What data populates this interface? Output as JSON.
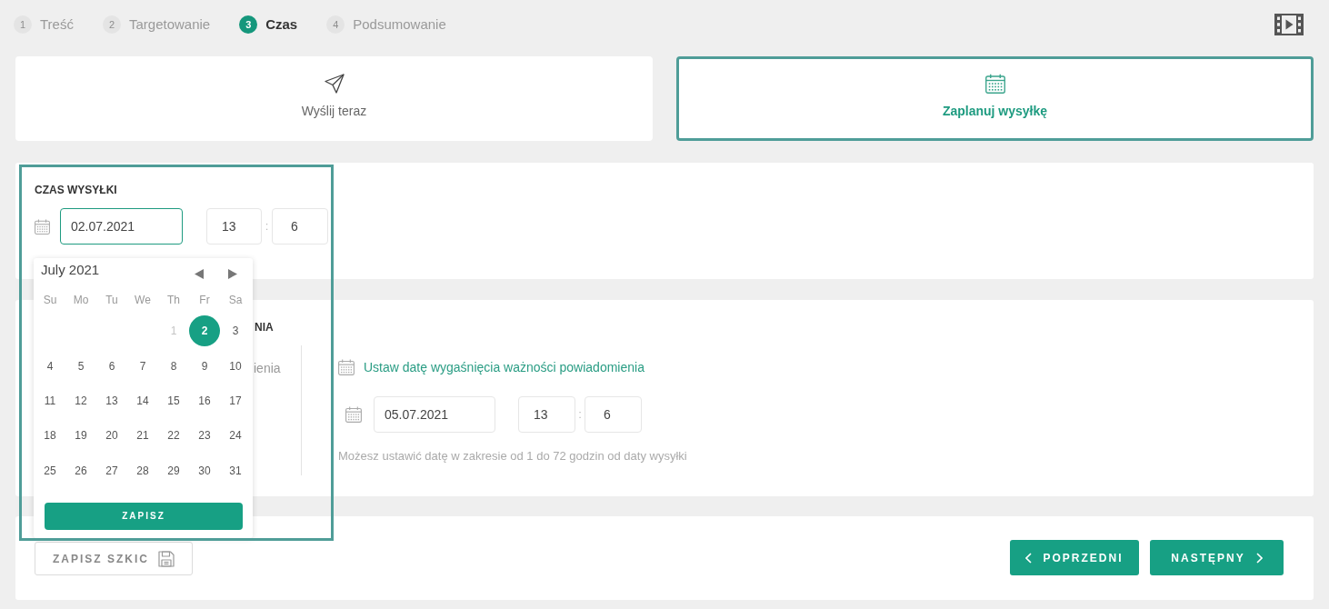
{
  "steps": [
    {
      "number": "1",
      "label": "Treść",
      "selected": false
    },
    {
      "number": "2",
      "label": "Targetowanie",
      "selected": false
    },
    {
      "number": "3",
      "label": "Czas",
      "selected": true
    },
    {
      "number": "4",
      "label": "Podsumowanie",
      "selected": false
    }
  ],
  "send_options": [
    {
      "kind": "now",
      "label": "Wyślij teraz",
      "selected": false
    },
    {
      "kind": "schedule",
      "label": "Zaplanuj wysyłkę",
      "selected": true
    }
  ],
  "send_time": {
    "title": "CZAS WYSYŁKI",
    "date": {
      "value": "02.07.2021",
      "focused": true
    },
    "hour": "13",
    "separator": ":",
    "minute": "6"
  },
  "date_picker": {
    "month": "July 2021",
    "weekdays": [
      "Su",
      "Mo",
      "Tu",
      "We",
      "Th",
      "Fr",
      "Sa"
    ],
    "weeks": [
      [
        {
          "label": "1",
          "disabled": true,
          "selected": false
        },
        {
          "label": "2",
          "disabled": false,
          "selected": true
        },
        {
          "label": "3",
          "disabled": false,
          "selected": false
        }
      ],
      [
        {
          "label": "4",
          "disabled": false,
          "selected": false
        },
        {
          "label": "5",
          "disabled": false,
          "selected": false
        },
        {
          "label": "6",
          "disabled": false,
          "selected": false
        },
        {
          "label": "7",
          "disabled": false,
          "selected": false
        },
        {
          "label": "8",
          "disabled": false,
          "selected": false
        },
        {
          "label": "9",
          "disabled": false,
          "selected": false
        },
        {
          "label": "10",
          "disabled": false,
          "selected": false
        }
      ],
      [
        {
          "label": "11",
          "disabled": false,
          "selected": false
        },
        {
          "label": "12",
          "disabled": false,
          "selected": false
        },
        {
          "label": "13",
          "disabled": false,
          "selected": false
        },
        {
          "label": "14",
          "disabled": false,
          "selected": false
        },
        {
          "label": "15",
          "disabled": false,
          "selected": false
        },
        {
          "label": "16",
          "disabled": false,
          "selected": false
        },
        {
          "label": "17",
          "disabled": false,
          "selected": false
        }
      ],
      [
        {
          "label": "18",
          "disabled": false,
          "selected": false
        },
        {
          "label": "19",
          "disabled": false,
          "selected": false
        },
        {
          "label": "20",
          "disabled": false,
          "selected": false
        },
        {
          "label": "21",
          "disabled": false,
          "selected": false
        },
        {
          "label": "22",
          "disabled": false,
          "selected": false
        },
        {
          "label": "23",
          "disabled": false,
          "selected": false
        },
        {
          "label": "24",
          "disabled": false,
          "selected": false
        }
      ],
      [
        {
          "label": "25",
          "disabled": false,
          "selected": false
        },
        {
          "label": "26",
          "disabled": false,
          "selected": false
        },
        {
          "label": "27",
          "disabled": false,
          "selected": false
        },
        {
          "label": "28",
          "disabled": false,
          "selected": false
        },
        {
          "label": "29",
          "disabled": false,
          "selected": false
        },
        {
          "label": "30",
          "disabled": false,
          "selected": false
        },
        {
          "label": "31",
          "disabled": false,
          "selected": false
        }
      ]
    ],
    "save_button": "ZAPISZ"
  },
  "expiry": {
    "title": "NIA",
    "description": "ienia",
    "link": "Ustaw datę wygaśnięcia ważności powiadomienia",
    "date": {
      "value": "05.07.2021",
      "focused": false
    },
    "hour": "13",
    "separator": ":",
    "minute": "6",
    "hint": "Możesz ustawić datę w zakresie od 1 do 72 godzin od daty wysyłki"
  },
  "footer": {
    "draft_button": "ZAPISZ SZKIC",
    "prev_button": "POPRZEDNI",
    "next_button": "NASTĘPNY"
  }
}
